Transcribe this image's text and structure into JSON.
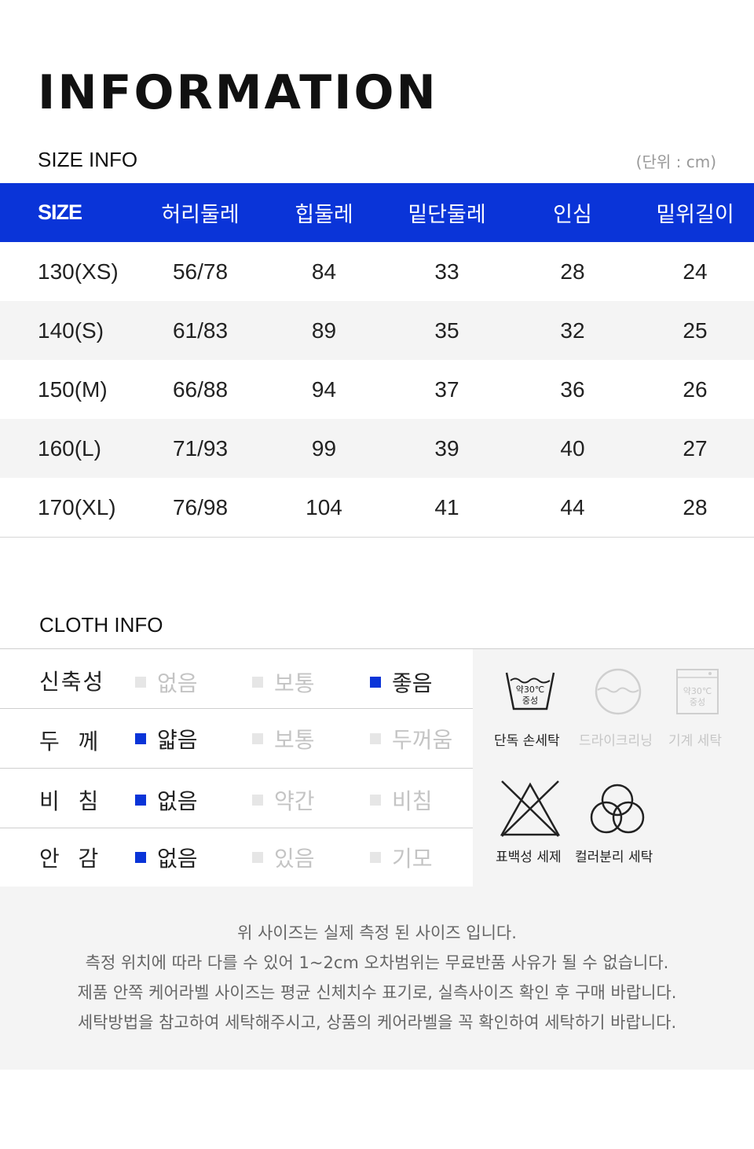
{
  "title": "INFORMATION",
  "size_info": {
    "label": "SIZE INFO",
    "unit": "(단위 : cm)",
    "headers": [
      "SIZE",
      "허리둘레",
      "힙둘레",
      "밑단둘레",
      "인심",
      "밑위길이"
    ],
    "rows": [
      [
        "130(XS)",
        "56/78",
        "84",
        "33",
        "28",
        "24"
      ],
      [
        "140(S)",
        "61/83",
        "89",
        "35",
        "32",
        "25"
      ],
      [
        "150(M)",
        "66/88",
        "94",
        "37",
        "36",
        "26"
      ],
      [
        "160(L)",
        "71/93",
        "99",
        "39",
        "40",
        "27"
      ],
      [
        "170(XL)",
        "76/98",
        "104",
        "41",
        "44",
        "28"
      ]
    ]
  },
  "cloth_info": {
    "label": "CLOTH INFO",
    "rows": [
      {
        "label": "신축성",
        "options": [
          {
            "text": "없음",
            "on": false
          },
          {
            "text": "보통",
            "on": false
          },
          {
            "text": "좋음",
            "on": true
          }
        ]
      },
      {
        "label": "두  께",
        "options": [
          {
            "text": "얇음",
            "on": true
          },
          {
            "text": "보통",
            "on": false
          },
          {
            "text": "두꺼움",
            "on": false
          }
        ]
      },
      {
        "label": "비  침",
        "options": [
          {
            "text": "없음",
            "on": true
          },
          {
            "text": "약간",
            "on": false
          },
          {
            "text": "비침",
            "on": false
          }
        ]
      },
      {
        "label": "안  감",
        "options": [
          {
            "text": "없음",
            "on": true
          },
          {
            "text": "있음",
            "on": false
          },
          {
            "text": "기모",
            "on": false
          }
        ]
      }
    ]
  },
  "care": {
    "hand_wash": {
      "label": "단독 손세탁",
      "icon": "hand-wash-icon",
      "temp": "약30℃",
      "detergent": "중성",
      "active": true
    },
    "dry_clean": {
      "label": "드라이크리닝",
      "icon": "dry-clean-icon",
      "active": false
    },
    "machine_wash": {
      "label": "기계 세탁",
      "icon": "machine-wash-icon",
      "temp": "약30℃",
      "detergent": "중성",
      "active": false
    },
    "no_bleach": {
      "label": "표백성 세제",
      "icon": "no-bleach-icon",
      "active": true
    },
    "separate": {
      "label": "컬러분리 세탁",
      "icon": "color-separate-icon",
      "active": true
    }
  },
  "notes": [
    "위 사이즈는 실제 측정 된 사이즈 입니다.",
    "측정 위치에 따라 다를 수 있어 1~2cm 오차범위는 무료반품 사유가 될 수 없습니다.",
    "제품 안쪽 케어라벨 사이즈는 평균 신체치수 표기로, 실측사이즈 확인 후 구매 바랍니다.",
    "세탁방법을 참고하여 세탁해주시고, 상품의 케어라벨을 꼭 확인하여 세탁하기 바랍니다."
  ],
  "colors": {
    "accent": "#0a34d8",
    "stripe": "#f4f4f4",
    "muted": "#c4c4c4"
  }
}
